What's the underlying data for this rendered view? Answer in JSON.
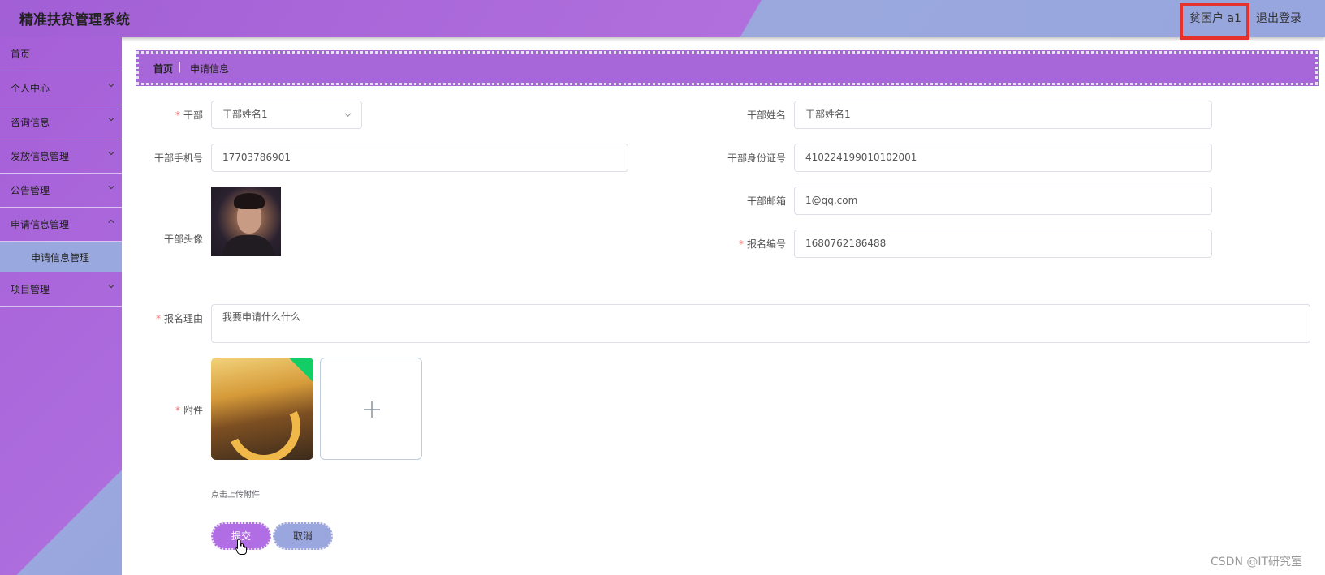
{
  "header": {
    "title": "精准扶贫管理系统",
    "user": "贫困户 a1",
    "logout": "退出登录"
  },
  "sidebar": {
    "items": [
      {
        "label": "首页"
      },
      {
        "label": "个人中心"
      },
      {
        "label": "咨询信息"
      },
      {
        "label": "发放信息管理"
      },
      {
        "label": "公告管理"
      },
      {
        "label": "申请信息管理"
      },
      {
        "label": "项目管理"
      }
    ],
    "submenu": {
      "label": "申请信息管理"
    }
  },
  "breadcrumb": {
    "home": "首页",
    "separator": "|",
    "current": "申请信息"
  },
  "form": {
    "cadre": {
      "label": "干部",
      "value": "干部姓名1",
      "required": true
    },
    "cadre_name": {
      "label": "干部姓名",
      "value": "干部姓名1"
    },
    "cadre_phone": {
      "label": "干部手机号",
      "value": "17703786901"
    },
    "cadre_id": {
      "label": "干部身份证号",
      "value": "410224199010102001"
    },
    "cadre_email": {
      "label": "干部邮箱",
      "value": "1@qq.com"
    },
    "cadre_avatar": {
      "label": "干部头像"
    },
    "reg_no": {
      "label": "报名编号",
      "value": "1680762186488",
      "required": true
    },
    "reason": {
      "label": "报名理由",
      "value": "我要申请什么什么",
      "required": true
    },
    "attachment": {
      "label": "附件",
      "required": true,
      "tip": "点击上传附件"
    }
  },
  "buttons": {
    "submit": "提交",
    "cancel": "取消"
  },
  "watermark": "CSDN @IT研究室",
  "colors": {
    "accent_purple": "#a867d9",
    "accent_blue": "#9aa8de",
    "required_star": "#f56c6c",
    "highlight_border": "#e5322d",
    "success_green": "#13ce66"
  }
}
